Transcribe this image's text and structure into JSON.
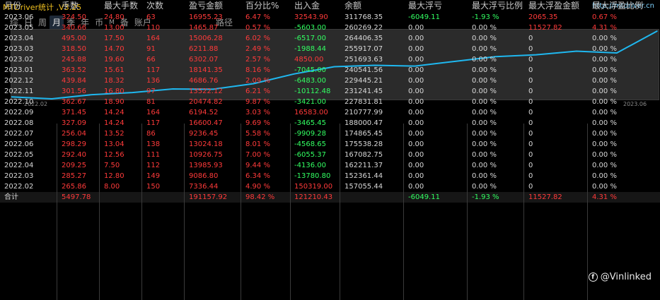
{
  "app": {
    "title": "MTDriver统计 ,V3.25",
    "url": "http://mtdriver.cn"
  },
  "tabs": [
    {
      "label": "综",
      "active": false
    },
    {
      "label": "日",
      "active": false
    },
    {
      "label": "周",
      "active": false
    },
    {
      "label": "月",
      "active": true
    },
    {
      "label": "季",
      "active": false
    },
    {
      "label": "年",
      "active": false
    },
    {
      "label": "币",
      "active": false
    },
    {
      "label": "M",
      "active": false
    },
    {
      "label": "备",
      "active": false
    },
    {
      "label": "账户",
      "active": false
    }
  ],
  "route_label": "路径",
  "chart_data": {
    "type": "line",
    "x": [
      "2022.02",
      "2022.03",
      "2022.04",
      "2022.05",
      "2022.06",
      "2022.07",
      "2022.08",
      "2022.09",
      "2022.10",
      "2022.11",
      "2022.12",
      "2023.01",
      "2023.02",
      "2023.03",
      "2023.04",
      "2023.05",
      "2023.06"
    ],
    "series": [
      {
        "values": [
          157055.44,
          152361.44,
          162211.37,
          167082.75,
          175538.28,
          174865.45,
          188000.47,
          210777.99,
          227831.81,
          231241.45,
          229445.21,
          240541.56,
          251693.63,
          255917.07,
          264406.35,
          260269.22,
          311768.35
        ]
      }
    ],
    "x_tick_labels": [
      "2022.02",
      "2023.06"
    ],
    "line_color": "#1fb8f0",
    "grid": false
  },
  "columns": [
    "月份",
    "手数",
    "最大手数",
    "次数",
    "盈亏金额",
    "百分比%",
    "出入金",
    "余额",
    "最大浮亏",
    "最大浮亏比例",
    "最大浮盈金额",
    "最大浮盈比例"
  ],
  "rows": [
    [
      "2023.06",
      "324.50",
      "24.80",
      "63",
      "16955.23",
      "6.47 %",
      "32543.90",
      "311768.35",
      "-6049.11",
      "-1.93 %",
      "2065.35",
      "0.67 %"
    ],
    [
      "2023.05",
      "340.66",
      "13.00",
      "110",
      "1465.87",
      "0.57 %",
      "-5603.00",
      "260269.22",
      "0.00",
      "0.00 %",
      "11527.82",
      "4.31 %"
    ],
    [
      "2023.04",
      "495.00",
      "17.50",
      "164",
      "15006.28",
      "6.02 %",
      "-6517.00",
      "264406.35",
      "0.00",
      "0.00 %",
      "0",
      "0.00 %"
    ],
    [
      "2023.03",
      "318.50",
      "14.70",
      "91",
      "6211.88",
      "2.49 %",
      "-1988.44",
      "255917.07",
      "0.00",
      "0.00 %",
      "0",
      "0.00 %"
    ],
    [
      "2023.02",
      "245.88",
      "19.60",
      "66",
      "6302.07",
      "2.57 %",
      "4850.00",
      "251693.63",
      "0.00",
      "0.00 %",
      "0",
      "0.00 %"
    ],
    [
      "2023.01",
      "363.52",
      "15.61",
      "117",
      "18141.35",
      "8.16 %",
      "-7045.00",
      "240541.56",
      "0.00",
      "0.00 %",
      "0",
      "0.00 %"
    ],
    [
      "2022.12",
      "439.84",
      "18.32",
      "136",
      "4686.76",
      "2.09 %",
      "-6483.00",
      "229445.21",
      "0.00",
      "0.00 %",
      "0",
      "0.00 %"
    ],
    [
      "2022.11",
      "301.56",
      "16.80",
      "97",
      "13522.12",
      "6.21 %",
      "-10112.48",
      "231241.45",
      "0.00",
      "0.00 %",
      "0",
      "0.00 %"
    ],
    [
      "2022.10",
      "362.67",
      "18.90",
      "81",
      "20474.82",
      "9.87 %",
      "-3421.00",
      "227831.81",
      "0.00",
      "0.00 %",
      "0",
      "0.00 %"
    ],
    [
      "2022.09",
      "371.45",
      "14.24",
      "164",
      "6194.52",
      "3.03 %",
      "16583.00",
      "210777.99",
      "0.00",
      "0.00 %",
      "0",
      "0.00 %"
    ],
    [
      "2022.08",
      "327.09",
      "14.24",
      "117",
      "16600.47",
      "9.69 %",
      "-3465.45",
      "188000.47",
      "0.00",
      "0.00 %",
      "0",
      "0.00 %"
    ],
    [
      "2022.07",
      "256.04",
      "13.52",
      "86",
      "9236.45",
      "5.58 %",
      "-9909.28",
      "174865.45",
      "0.00",
      "0.00 %",
      "0",
      "0.00 %"
    ],
    [
      "2022.06",
      "298.29",
      "13.04",
      "138",
      "13024.18",
      "8.01 %",
      "-4568.65",
      "175538.28",
      "0.00",
      "0.00 %",
      "0",
      "0.00 %"
    ],
    [
      "2022.05",
      "292.40",
      "12.56",
      "111",
      "10926.75",
      "7.00 %",
      "-6055.37",
      "167082.75",
      "0.00",
      "0.00 %",
      "0",
      "0.00 %"
    ],
    [
      "2022.04",
      "209.25",
      "7.50",
      "112",
      "13985.93",
      "9.44 %",
      "-4136.00",
      "162211.37",
      "0.00",
      "0.00 %",
      "0",
      "0.00 %"
    ],
    [
      "2022.03",
      "285.27",
      "12.80",
      "149",
      "9086.80",
      "6.34 %",
      "-13780.80",
      "152361.44",
      "0.00",
      "0.00 %",
      "0",
      "0.00 %"
    ],
    [
      "2022.02",
      "265.86",
      "8.00",
      "150",
      "7336.44",
      "4.90 %",
      "150319.00",
      "157055.44",
      "0.00",
      "0.00 %",
      "0",
      "0.00 %"
    ]
  ],
  "totals": [
    "合计",
    "5497.78",
    "",
    "",
    "191157.92",
    "98.42 %",
    "121210.43",
    "",
    "-6049.11",
    "-1.93 %",
    "11527.82",
    "4.31 %"
  ],
  "watermark": "@Vinlinked",
  "colors": {
    "positive": "#ff3a3a",
    "negative": "#32ff62",
    "title": "#f0c020",
    "line": "#1fb8f0"
  }
}
